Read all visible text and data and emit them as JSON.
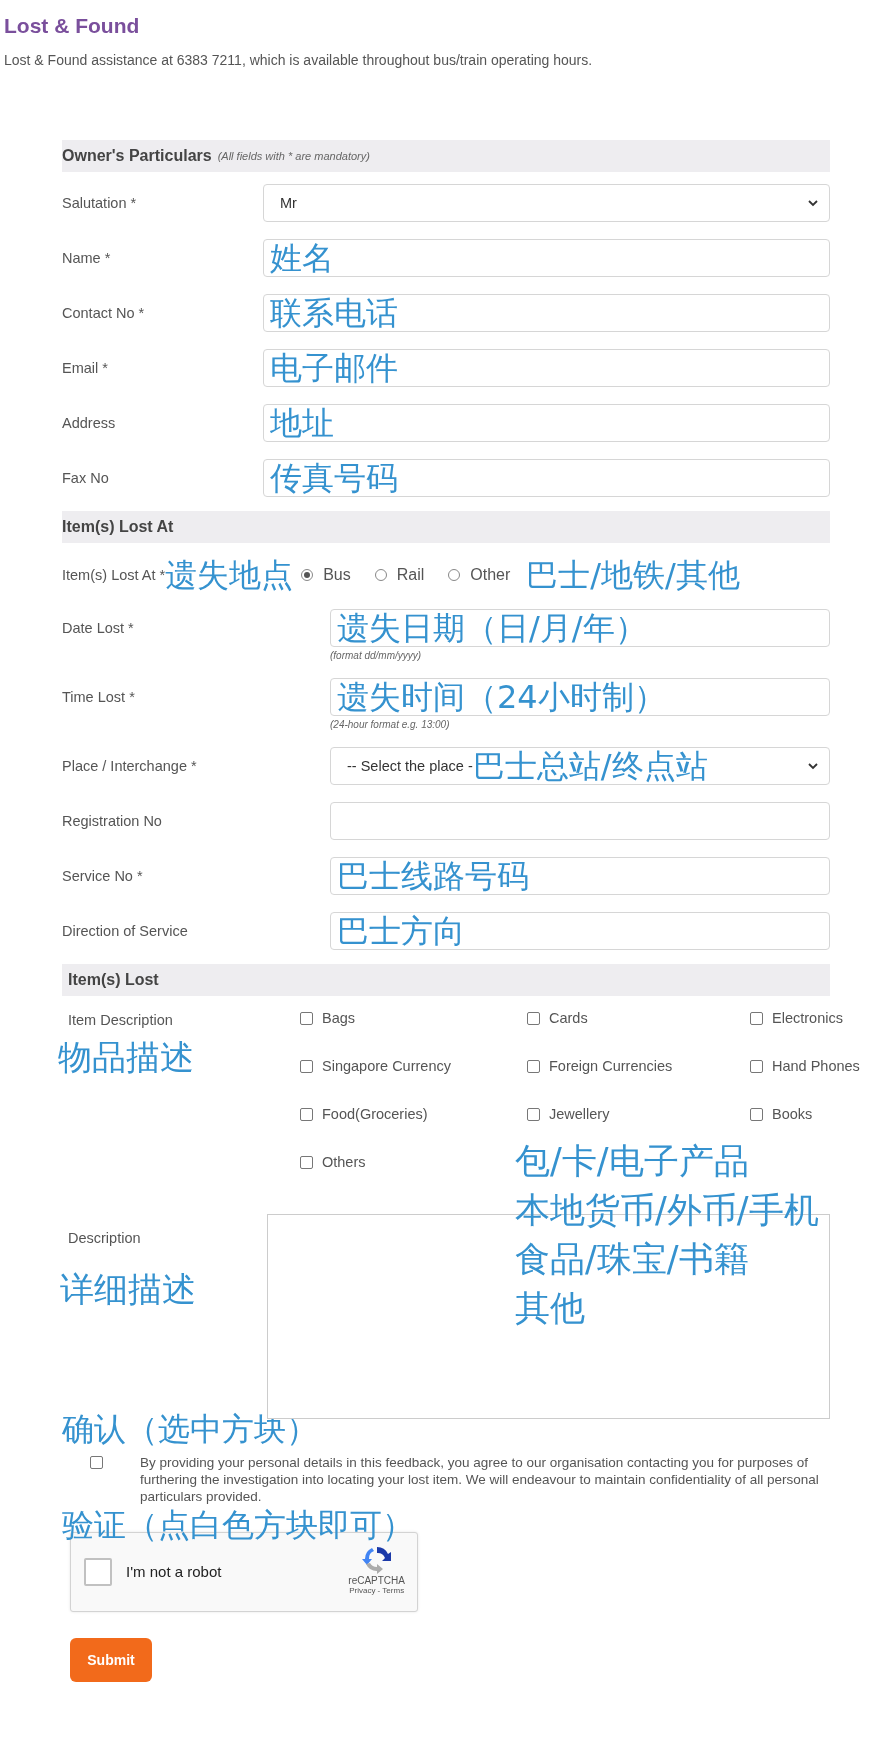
{
  "header": {
    "title": "Lost & Found",
    "subtitle": "Lost & Found assistance at 6383 7211, which is available throughout bus/train operating hours."
  },
  "owner": {
    "heading": "Owner's Particulars",
    "note": "(All fields with * are mandatory)",
    "fields": [
      {
        "label": "Salutation *",
        "kind": "select",
        "value": "Mr"
      },
      {
        "label": "Name *",
        "kind": "text",
        "annotation": "姓名"
      },
      {
        "label": "Contact No *",
        "kind": "text",
        "annotation": "联系电话"
      },
      {
        "label": "Email *",
        "kind": "text",
        "annotation": "电子邮件"
      },
      {
        "label": "Address",
        "kind": "text",
        "annotation": "地址"
      },
      {
        "label": "Fax No",
        "kind": "text",
        "annotation": "传真号码"
      }
    ]
  },
  "lost_at": {
    "heading": "Item(s) Lost At",
    "location": {
      "label": "Item(s) Lost At *",
      "annotation": "遗失地点",
      "options": [
        {
          "label": "Bus",
          "selected": true
        },
        {
          "label": "Rail",
          "selected": false
        },
        {
          "label": "Other",
          "selected": false
        }
      ],
      "options_annotation": "巴士/地铁/其他"
    },
    "fields": [
      {
        "label": "Date Lost *",
        "kind": "text",
        "annotation": "遗失日期（日/月/年）",
        "hint": "(format dd/mm/yyyy)"
      },
      {
        "label": "Time Lost *",
        "kind": "text",
        "annotation": "遗失时间（24小时制）",
        "hint": "(24-hour format e.g. 13:00)"
      },
      {
        "label": "Place / Interchange *",
        "kind": "select",
        "value": "-- Select the place -",
        "annotation": "巴士总站/终点站"
      },
      {
        "label": "Registration No",
        "kind": "text"
      },
      {
        "label": "Service No *",
        "kind": "text",
        "annotation": "巴士线路号码"
      },
      {
        "label": "Direction of Service",
        "kind": "text",
        "annotation": "巴士方向"
      }
    ]
  },
  "items_lost": {
    "heading": "Item(s) Lost",
    "label": "Item Description",
    "label_annotation": "物品描述",
    "options": [
      {
        "label": "Bags",
        "checked": false
      },
      {
        "label": "Cards",
        "checked": false
      },
      {
        "label": "Electronics",
        "checked": false
      },
      {
        "label": "Singapore Currency",
        "checked": false
      },
      {
        "label": "Foreign Currencies",
        "checked": false
      },
      {
        "label": "Hand Phones",
        "checked": false
      },
      {
        "label": "Food(Groceries)",
        "checked": false
      },
      {
        "label": "Jewellery",
        "checked": false
      },
      {
        "label": "Books",
        "checked": false
      },
      {
        "label": "Others",
        "checked": false
      }
    ],
    "annotation_lines": [
      "包/卡/电子产品",
      "本地货币/外币/手机",
      "食品/珠宝/书籍",
      "其他"
    ],
    "description_label": "Description",
    "description_annotation": "详细描述"
  },
  "consent": {
    "annotation": "确认（选中方块）",
    "checked": false,
    "text": "By providing your personal details in this feedback, you agree to our organisation contacting you for purposes of furthering the investigation into locating your lost item. We will endeavour to maintain confidentiality of all personal particulars provided."
  },
  "captcha": {
    "annotation": "验证（点白色方块即可）",
    "checked": false,
    "label": "I'm not a robot",
    "brand": "reCAPTCHA",
    "links": "Privacy - Terms"
  },
  "submit": "Submit"
}
